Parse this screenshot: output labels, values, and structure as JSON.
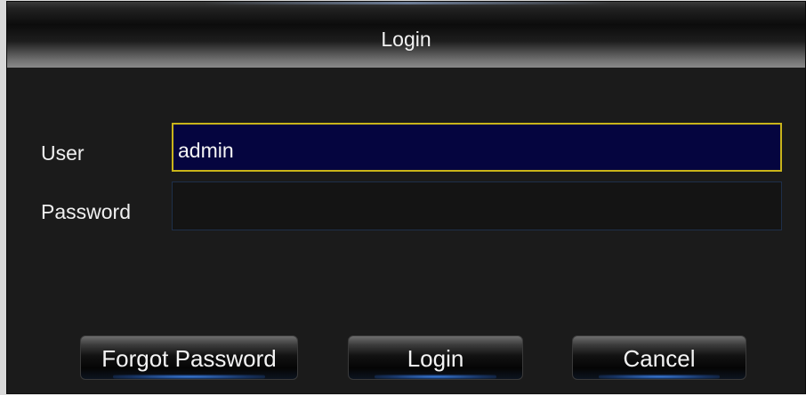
{
  "dialog": {
    "title": "Login"
  },
  "form": {
    "user_label": "User",
    "user_value": "admin",
    "password_label": "Password",
    "password_value": ""
  },
  "buttons": {
    "forgot_password": "Forgot Password",
    "login": "Login",
    "cancel": "Cancel"
  },
  "colors": {
    "dialog_background": "#1b1b1b",
    "focused_input_background": "#05053f",
    "focused_input_border": "#c9b41a",
    "button_glow": "#3c7fe0"
  }
}
